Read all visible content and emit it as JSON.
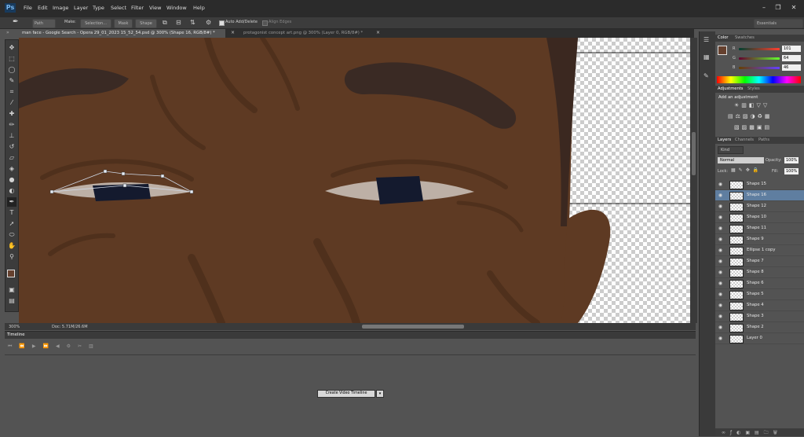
{
  "app": {
    "logo": "Ps",
    "menu": [
      "File",
      "Edit",
      "Image",
      "Layer",
      "Type",
      "Select",
      "Filter",
      "View",
      "Window",
      "Help"
    ],
    "workspace": "Essentials"
  },
  "options_bar": {
    "mode": "Path",
    "make_label": "Make:",
    "selection_btn": "Selection...",
    "mask_btn": "Mask",
    "shape_btn": "Shape",
    "auto_add_delete": "Auto Add/Delete",
    "align_edges": "Align Edges"
  },
  "tabs": [
    {
      "label": "man face - Google Search - Opera 29_01_2023 15_52_54.psd @ 300% (Shape 16, RGB/8#) *",
      "active": true
    },
    {
      "label": "protagonist concept art.png @ 300% (Layer 0, RGB/8#) *",
      "active": false
    }
  ],
  "status": {
    "zoom": "300%",
    "doc": "Doc: 5.71M/26.6M"
  },
  "timeline": {
    "title": "Timeline",
    "create_btn": "Create Video Timeline"
  },
  "color_panel": {
    "tabs": [
      "Color",
      "Swatches"
    ],
    "r": "101",
    "g": "64",
    "b": "46",
    "r_label": "R",
    "g_label": "G",
    "b_label": "B",
    "fg_color": "#65402e"
  },
  "adjustments_panel": {
    "tabs": [
      "Adjustments",
      "Styles"
    ],
    "heading": "Add an adjustment"
  },
  "layers_panel": {
    "tabs": [
      "Layers",
      "Channels",
      "Paths"
    ],
    "kind": "Kind",
    "blend_mode": "Normal",
    "opacity_label": "Opacity:",
    "opacity": "100%",
    "lock_label": "Lock:",
    "fill_label": "Fill:",
    "fill": "100%",
    "layers": [
      {
        "name": "Shape 15",
        "selected": false
      },
      {
        "name": "Shape 16",
        "selected": true
      },
      {
        "name": "Shape 12",
        "selected": false
      },
      {
        "name": "Shape 10",
        "selected": false
      },
      {
        "name": "Shape 11",
        "selected": false
      },
      {
        "name": "Shape 9",
        "selected": false
      },
      {
        "name": "Ellipse 1 copy",
        "selected": false
      },
      {
        "name": "Shape 7",
        "selected": false
      },
      {
        "name": "Shape 8",
        "selected": false
      },
      {
        "name": "Shape 6",
        "selected": false
      },
      {
        "name": "Shape 5",
        "selected": false
      },
      {
        "name": "Shape 4",
        "selected": false
      },
      {
        "name": "Shape 3",
        "selected": false
      },
      {
        "name": "Shape 2",
        "selected": false
      },
      {
        "name": "Layer 0",
        "selected": false
      }
    ]
  },
  "colors": {
    "skin": "#5e3a23",
    "brow": "#3a2a24",
    "iris": "#141a2e",
    "sclera": "#bdb0a6",
    "selected_layer": "#5f7ea0"
  }
}
